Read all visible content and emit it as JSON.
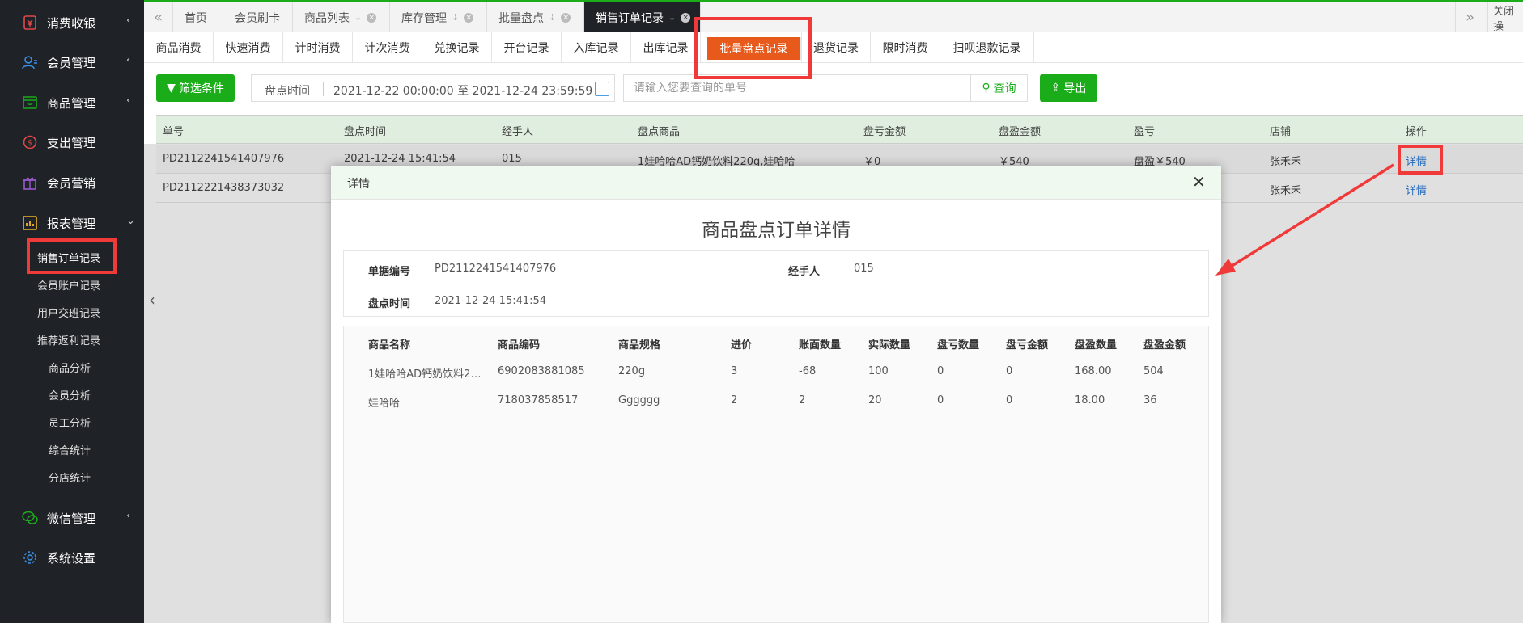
{
  "sidebar": {
    "items": [
      {
        "label": "消费收银",
        "icon": "cashier-icon"
      },
      {
        "label": "会员管理",
        "icon": "member-icon"
      },
      {
        "label": "商品管理",
        "icon": "goods-icon"
      },
      {
        "label": "支出管理",
        "icon": "expense-icon"
      },
      {
        "label": "会员营销",
        "icon": "gift-icon"
      },
      {
        "label": "报表管理",
        "icon": "report-icon"
      },
      {
        "label": "微信管理",
        "icon": "wechat-icon"
      },
      {
        "label": "系统设置",
        "icon": "gear-icon"
      }
    ],
    "sub_items": [
      "销售订单记录",
      "会员账户记录",
      "用户交班记录",
      "推荐返利记录",
      "商品分析",
      "会员分析",
      "员工分析",
      "综合统计",
      "分店统计"
    ]
  },
  "tabs": [
    {
      "label": "首页"
    },
    {
      "label": "会员刷卡"
    },
    {
      "label": "商品列表"
    },
    {
      "label": "库存管理"
    },
    {
      "label": "批量盘点"
    },
    {
      "label": "销售订单记录"
    }
  ],
  "tab_right_label": "关闭操",
  "subtabs": [
    "商品消费",
    "快速消费",
    "计时消费",
    "计次消费",
    "兑换记录",
    "开台记录",
    "入库记录",
    "出库记录",
    "批量盘点记录",
    "退货记录",
    "限时消费",
    "扫呗退款记录"
  ],
  "filter": {
    "button_label": "筛选条件",
    "date_label": "盘点时间",
    "date_value": "2021-12-22 00:00:00 至 2021-12-24 23:59:59",
    "search_placeholder": "请输入您要查询的单号",
    "search_button": "查询",
    "export_button": "导出"
  },
  "table": {
    "headers": [
      "单号",
      "盘点时间",
      "经手人",
      "盘点商品",
      "盘亏金额",
      "盘盈金额",
      "盈亏",
      "店铺",
      "操作"
    ],
    "rows": [
      [
        "PD2112241541407976",
        "2021-12-24 15:41:54",
        "015",
        "1娃哈哈AD钙奶饮料220g,娃哈哈",
        "￥0",
        "￥540",
        "盘盈￥540",
        "张禾禾",
        "详情"
      ],
      [
        "PD2112221438373032",
        "",
        "",
        "",
        "",
        "",
        "",
        "张禾禾",
        "详情"
      ]
    ]
  },
  "modal": {
    "header_title": "详情",
    "title": "商品盘点订单详情",
    "info": {
      "order_no_label": "单据编号",
      "order_no": "PD2112241541407976",
      "handler_label": "经手人",
      "handler": "015",
      "time_label": "盘点时间",
      "time": "2021-12-24 15:41:54"
    },
    "item_headers": [
      "商品名称",
      "商品编码",
      "商品规格",
      "进价",
      "账面数量",
      "实际数量",
      "盘亏数量",
      "盘亏金额",
      "盘盈数量",
      "盘盈金额"
    ],
    "items": [
      [
        "1娃哈哈AD钙奶饮料2…",
        "6902083881085",
        "220g",
        "3",
        "-68",
        "100",
        "0",
        "0",
        "168.00",
        "504"
      ],
      [
        "娃哈哈",
        "718037858517",
        "Gggggg",
        "2",
        "2",
        "20",
        "0",
        "0",
        "18.00",
        "36"
      ]
    ]
  },
  "colors": {
    "green": "#1aad19",
    "active_subtab": "#e85a1b",
    "annotation_red": "#f03a3a",
    "sidebar_bg": "#1f2226"
  }
}
